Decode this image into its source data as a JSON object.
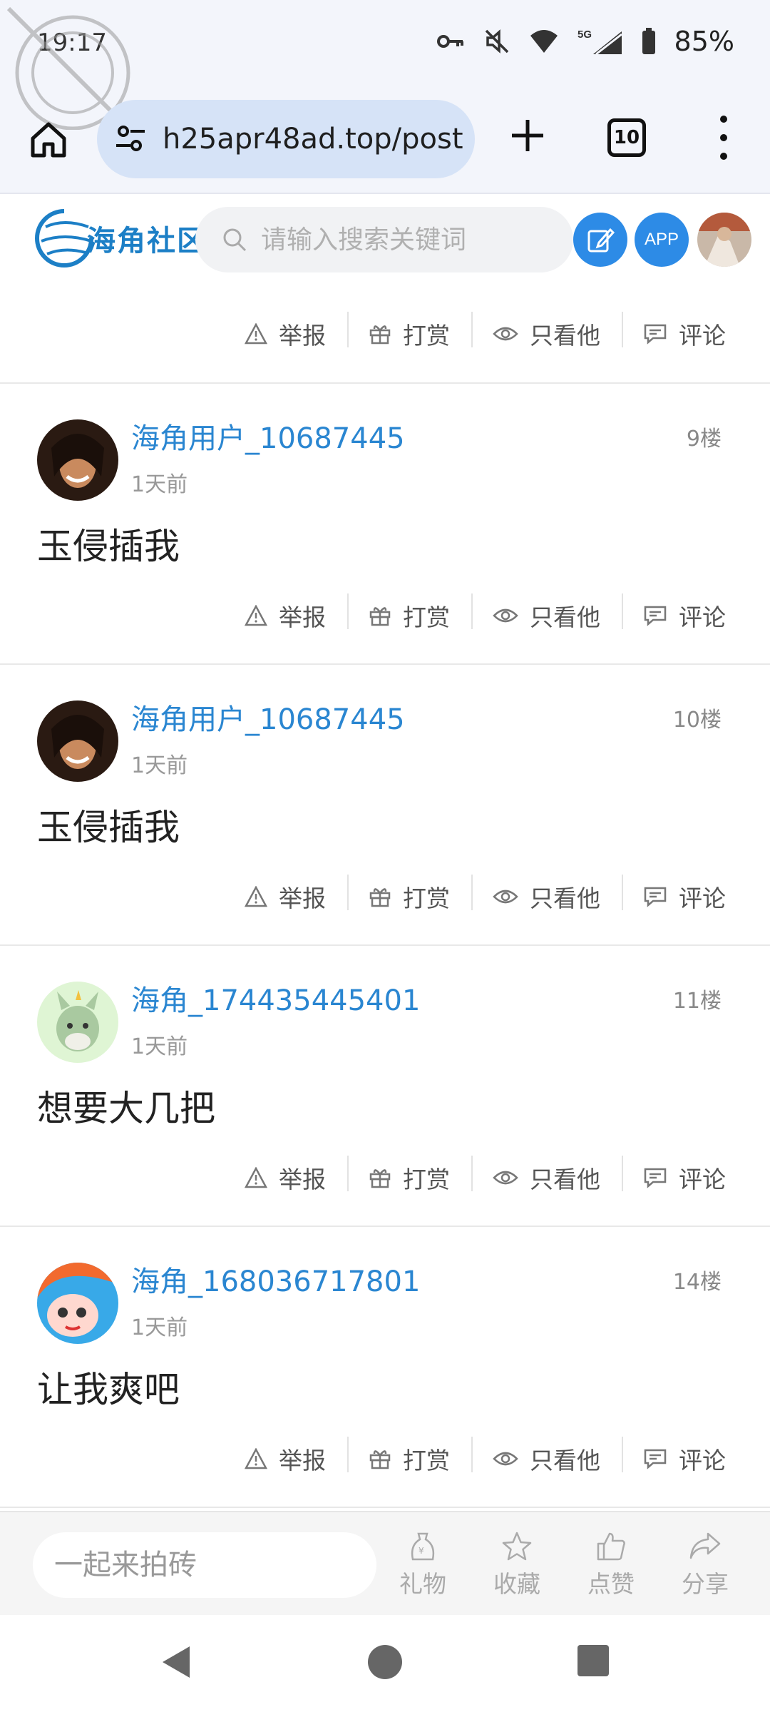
{
  "status_bar": {
    "time": "19:17",
    "network": "5G",
    "battery": "85%"
  },
  "browser": {
    "url": "h25apr48ad.top/post",
    "tab_count": "10"
  },
  "site": {
    "logo_text": "海角社区",
    "search_placeholder": "请输入搜索关键词",
    "app_label": "APP"
  },
  "actions": {
    "report": "举报",
    "reward": "打赏",
    "only_him": "只看他",
    "comment": "评论"
  },
  "posts": [
    {
      "username": "海角用户_10687445",
      "time": "1天前",
      "floor": "9楼",
      "content": "玉侵插我"
    },
    {
      "username": "海角用户_10687445",
      "time": "1天前",
      "floor": "10楼",
      "content": "玉侵插我"
    },
    {
      "username": "海角_174435445401",
      "time": "1天前",
      "floor": "11楼",
      "content": "想要大几把"
    },
    {
      "username": "海角_168036717801",
      "time": "1天前",
      "floor": "14楼",
      "content": "让我爽吧"
    }
  ],
  "bottom_bar": {
    "comment_placeholder": "一起来拍砖",
    "gift": "礼物",
    "favorite": "收藏",
    "like": "点赞",
    "share": "分享"
  },
  "colors": {
    "accent_blue": "#2d8be6",
    "username_blue": "#2a86d1",
    "url_pill": "#d6e3f7"
  },
  "icons": [
    "key-icon",
    "mute-icon",
    "wifi-icon",
    "signal-icon",
    "battery-icon",
    "home-icon",
    "tune-icon",
    "plus-icon",
    "tabs-icon",
    "more-icon",
    "search-icon",
    "edit-icon",
    "warning-icon",
    "gift-icon",
    "eye-icon",
    "comment-icon",
    "star-icon",
    "thumb-up-icon",
    "share-icon"
  ]
}
